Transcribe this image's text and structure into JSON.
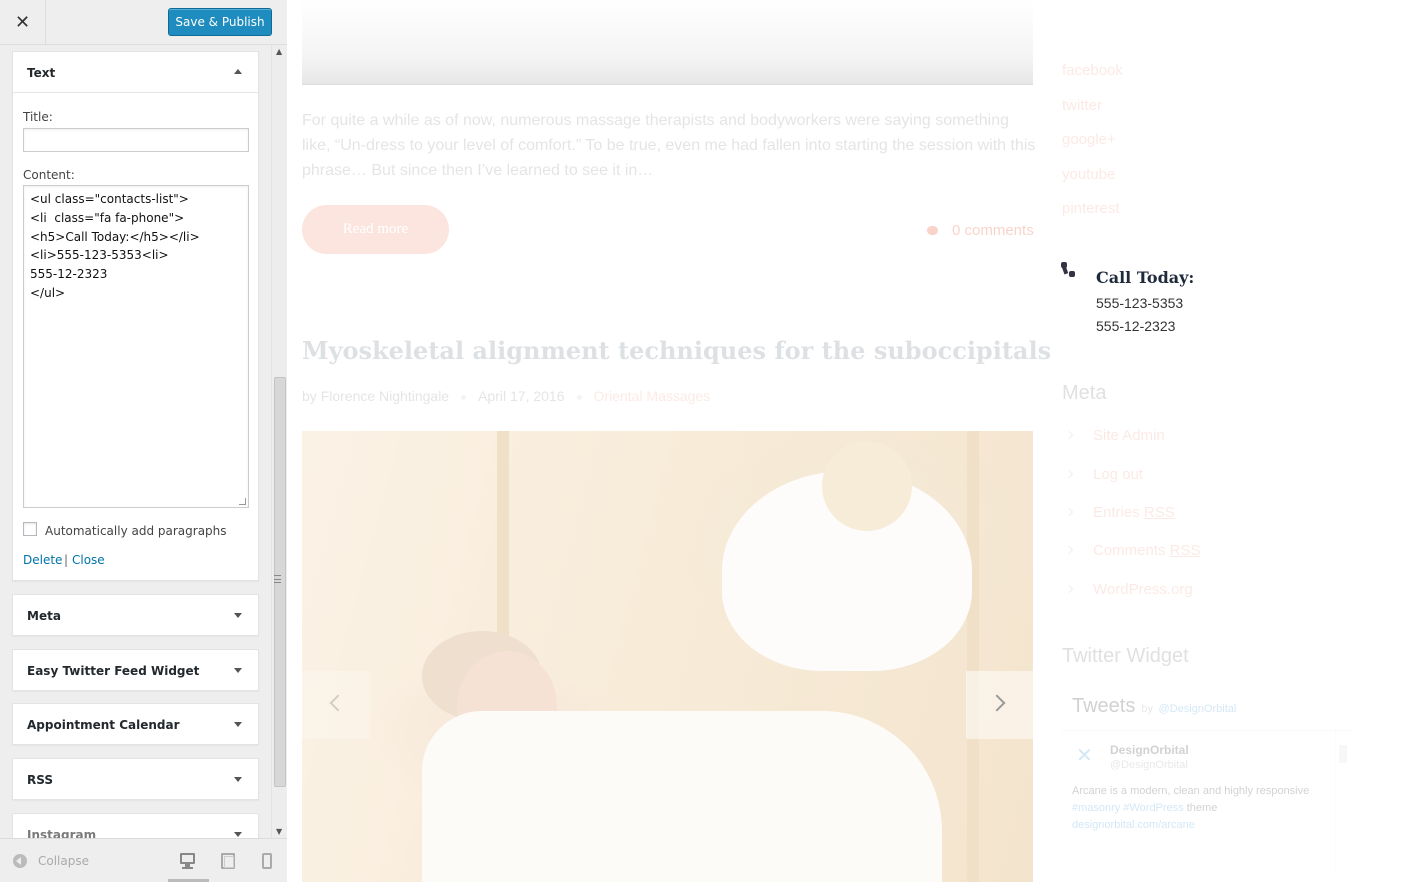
{
  "customizer": {
    "close_glyph": "✕",
    "save_label": "Save & Publish",
    "text_widget": {
      "title": "Text",
      "title_label": "Title:",
      "title_value": "",
      "content_label": "Content:",
      "content_lines": [
        "<ul class=\"contacts-list\">",
        "<li  class=\"fa fa-phone\">",
        "<h5>Call Today:</h5></li>",
        "<li>555-123-5353<li>",
        "555-12-2323",
        "</ul>"
      ],
      "autop_label": "Automatically add paragraphs",
      "autop_checked": false,
      "delete_label": "Delete",
      "separator": "|",
      "close_label": "Close"
    },
    "widgets": [
      {
        "title": "Meta"
      },
      {
        "title": "Easy Twitter Feed Widget"
      },
      {
        "title": "Appointment Calendar"
      },
      {
        "title": "RSS"
      },
      {
        "title": "Instagram"
      }
    ],
    "footer": {
      "collapse_label": "Collapse",
      "devices": [
        "desktop-icon",
        "tablet-icon",
        "mobile-icon"
      ]
    }
  },
  "preview": {
    "excerpt": "For quite a while as of now, numerous massage therapists and bodyworkers were saying something like, “Un-dress to your level of comfort.” To be true, even me had fallen into starting the session with this phrase… But since then I’ve learned to see it in…",
    "read_more": "Read more",
    "comments": "0 comments",
    "post_title": "Myoskeletal alignment techniques for the suboccipitals",
    "post_meta": {
      "by": "by",
      "author": "Florence Nightingale",
      "date": "April 17, 2016",
      "category": "Oriental Massages"
    },
    "social_links": [
      "facebook",
      "twitter",
      "google+",
      "youtube",
      "pinterest"
    ],
    "contact": {
      "heading": "Call Today:",
      "phone1": "555-123-5353",
      "phone2": "555-12-2323"
    },
    "meta_widget": {
      "title": "Meta",
      "items": [
        {
          "pre": "Site Admin",
          "abbr": "",
          "post": ""
        },
        {
          "pre": "Log out",
          "abbr": "",
          "post": ""
        },
        {
          "pre": "Entries ",
          "abbr": "RSS",
          "post": ""
        },
        {
          "pre": "Comments ",
          "abbr": "RSS",
          "post": ""
        },
        {
          "pre": "WordPress.org",
          "abbr": "",
          "post": ""
        }
      ]
    },
    "twitter_widget": {
      "title": "Twitter Widget",
      "tweets_label": "Tweets",
      "by": "by",
      "handle_link": "@DesignOrbital",
      "user_name": "DesignOrbital",
      "user_handle": "@DesignOrbital",
      "tweet_text_a": "Arcane is a modern, clean and highly responsive ",
      "tweet_tag1": "#masonry",
      "tweet_tag2": "#WordPress",
      "tweet_text_b": " theme ",
      "tweet_link": "designorbital.com/arcane"
    }
  },
  "colors": {
    "primary_button": "#1e8cbe",
    "link": "#0073aa",
    "accent": "#f3a08b",
    "heading_dark": "#1f2a3d"
  }
}
